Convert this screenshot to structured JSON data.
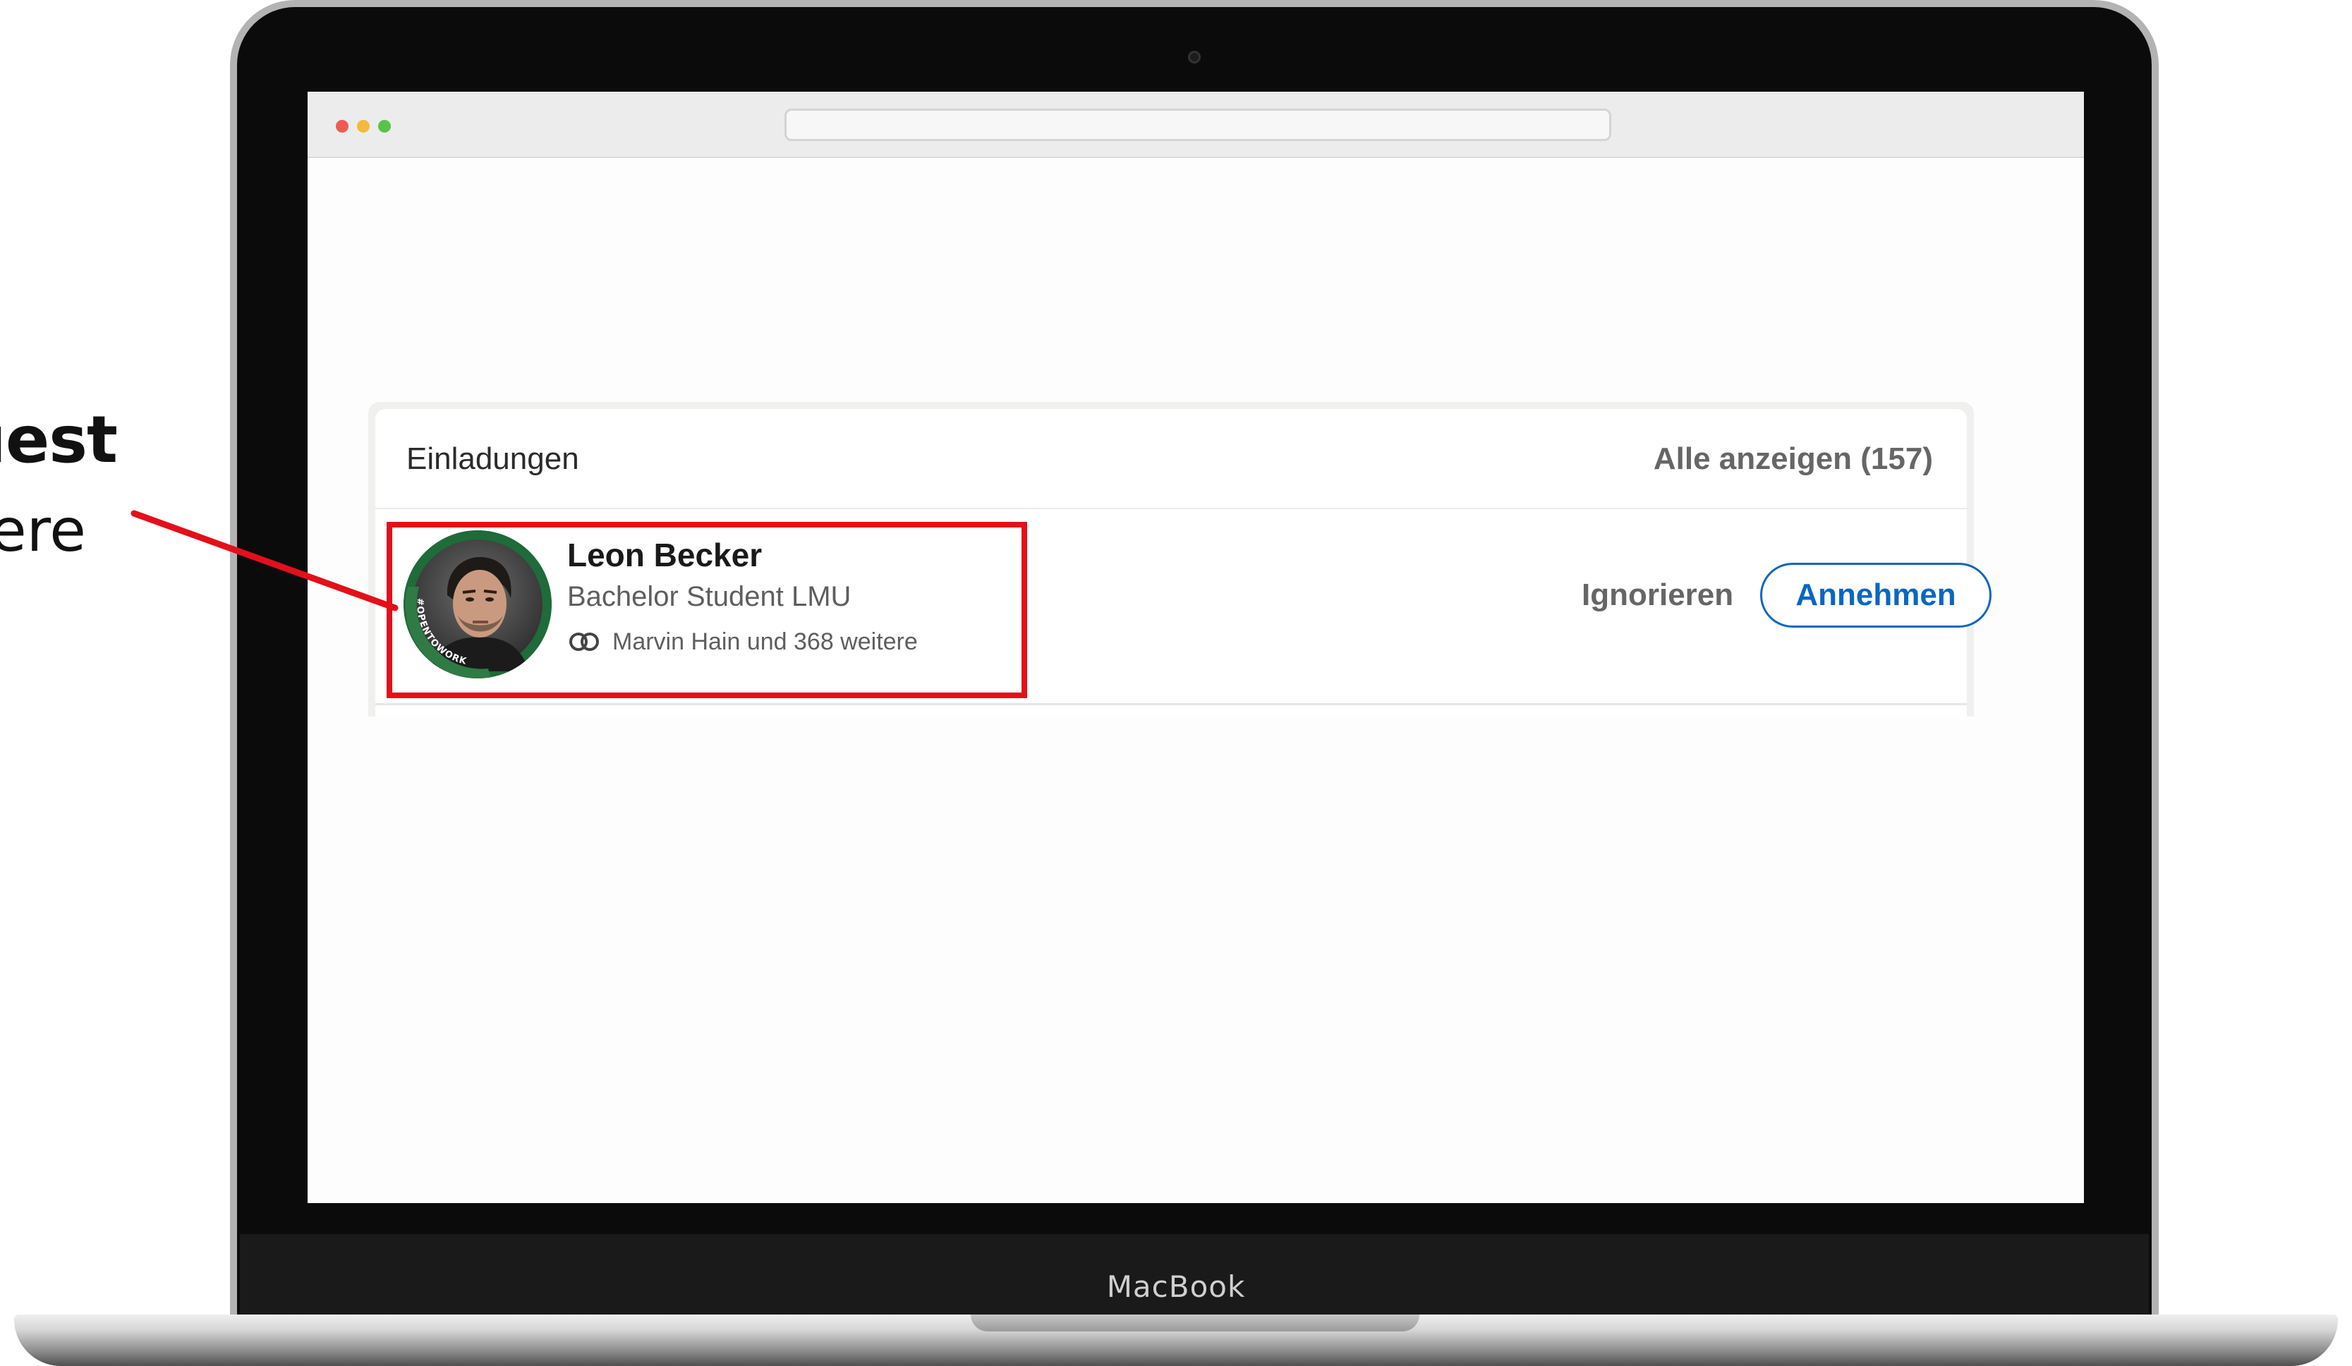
{
  "annotation": {
    "line1": "uest",
    "line2": "ere"
  },
  "device": {
    "label": "MacBook"
  },
  "invitations": {
    "title": "Einladungen",
    "see_all": "Alle anzeigen (157)"
  },
  "invitation": {
    "name": "Leon Becker",
    "headline": "Bachelor Student LMU",
    "mutual_connections": "Marvin Hain und 368 weitere",
    "avatar_badge": "#OPENTOWORK",
    "ignore_label": "Ignorieren",
    "accept_label": "Annehmen"
  },
  "colors": {
    "accent": "#0a66c2",
    "highlight": "#e3101a",
    "open_to_work_green": "#1f6b3a"
  }
}
